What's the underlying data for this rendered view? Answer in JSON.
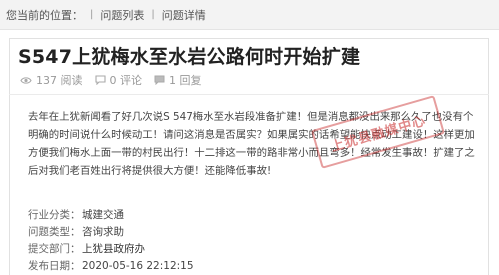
{
  "breadcrumb": {
    "prefix": "您当前的位置：",
    "items": [
      "问题列表",
      "问题详情"
    ],
    "separator": "|"
  },
  "post": {
    "title": "S547上犹梅水至水岩公路何时开始扩建",
    "views": "137 阅读",
    "comments": "0 评论",
    "replies": "1 回复",
    "body": "去年在上犹新闻看了好几次说S 547梅水至水岩段准备扩建！但是消息都没出来那么久了也没有个明确的时间说什么时候动工！请问这消息是否属实？如果属实的话希望能快点动工建设！这样更加方便我们梅水上面一带的村民出行！十二排这一带的路非常小而且弯多！经常发生事故！扩建了之后对我们老百姓出行将提供很大方便！还能降低事故!",
    "watermark": "上犹县融媒中心"
  },
  "details": [
    {
      "label": "行业分类：",
      "value": "城建交通"
    },
    {
      "label": "问题类型：",
      "value": "咨询求助"
    },
    {
      "label": "提交部门：",
      "value": "上犹县政府办"
    },
    {
      "label": "发布日期：",
      "value": "2020-05-16 22:12:15"
    }
  ],
  "colors": {
    "breadcrumb_bg": "#f3f3f3",
    "watermark": "#c82828"
  },
  "icons": [
    "eye-icon",
    "comment-icon",
    "reply-icon"
  ]
}
